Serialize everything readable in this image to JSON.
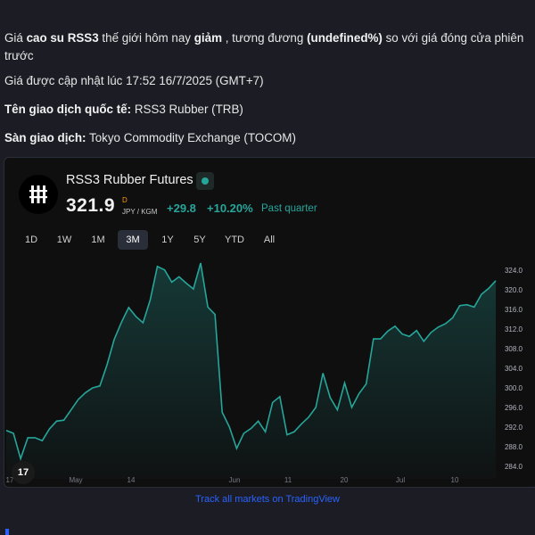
{
  "intro": {
    "part1": "Giá ",
    "commodity": "cao su RSS3",
    "part2": " thế giới hôm nay ",
    "direction": "giảm",
    "part3": " , tương đương ",
    "percent": "(undefined%)",
    "part4": " so với giá đóng cửa phiên trước"
  },
  "updated": "Giá được cập nhật lúc 17:52 16/7/2025 (GMT+7)",
  "intl_name": {
    "label": "Tên giao dịch quốc tế:",
    "value": " RSS3 Rubber (TRB)"
  },
  "exchange": {
    "label": "Sàn giao dịch:",
    "value": " Tokyo Commodity Exchange (TOCOM)"
  },
  "widget": {
    "symbol_name": "RSS3 Rubber Futures",
    "price": "321.9",
    "price_marker": "D",
    "unit": "JPY / KGM",
    "change": "+29.8",
    "change_pct": "+10.20%",
    "period": "Past quarter",
    "tabs": [
      "1D",
      "1W",
      "1M",
      "3M",
      "1Y",
      "5Y",
      "YTD",
      "All"
    ],
    "active_tab": "3M",
    "badge": "17",
    "track_link": "Track all markets on TradingView"
  },
  "colors": {
    "accent": "#26a69a",
    "link": "#2962ff",
    "background": "#1c1c24"
  },
  "chart_data": {
    "type": "area",
    "x_ticks": [
      "17",
      "May",
      "14",
      "Jun",
      "11",
      "20",
      "Jul",
      "10"
    ],
    "y_ticks": [
      284.0,
      288.0,
      292.0,
      296.0,
      300.0,
      304.0,
      308.0,
      312.0,
      316.0,
      320.0,
      324.0
    ],
    "ylim": [
      282.5,
      325.5
    ],
    "values": [
      291.3,
      290.7,
      285.5,
      289.8,
      289.8,
      289.2,
      291.6,
      293.2,
      293.4,
      295.5,
      297.6,
      299.0,
      300.0,
      300.4,
      304.7,
      309.9,
      313.4,
      316.4,
      314.6,
      313.3,
      318.0,
      324.8,
      324.1,
      321.6,
      322.7,
      321.4,
      320.2,
      325.5,
      316.5,
      315.0,
      295.0,
      292.0,
      287.6,
      290.7,
      291.7,
      293.2,
      291.0,
      297.0,
      298.2,
      290.4,
      291.0,
      292.6,
      294.0,
      296.0,
      303.0,
      298.0,
      295.5,
      301.0,
      296.0,
      298.8,
      300.8,
      310.0,
      310.0,
      311.6,
      312.6,
      311.0,
      310.5,
      311.7,
      309.5,
      311.3,
      312.4,
      313.1,
      314.3,
      316.8,
      317.0,
      316.5,
      319.1,
      320.3,
      321.9
    ],
    "grid": false,
    "legend": "none"
  }
}
